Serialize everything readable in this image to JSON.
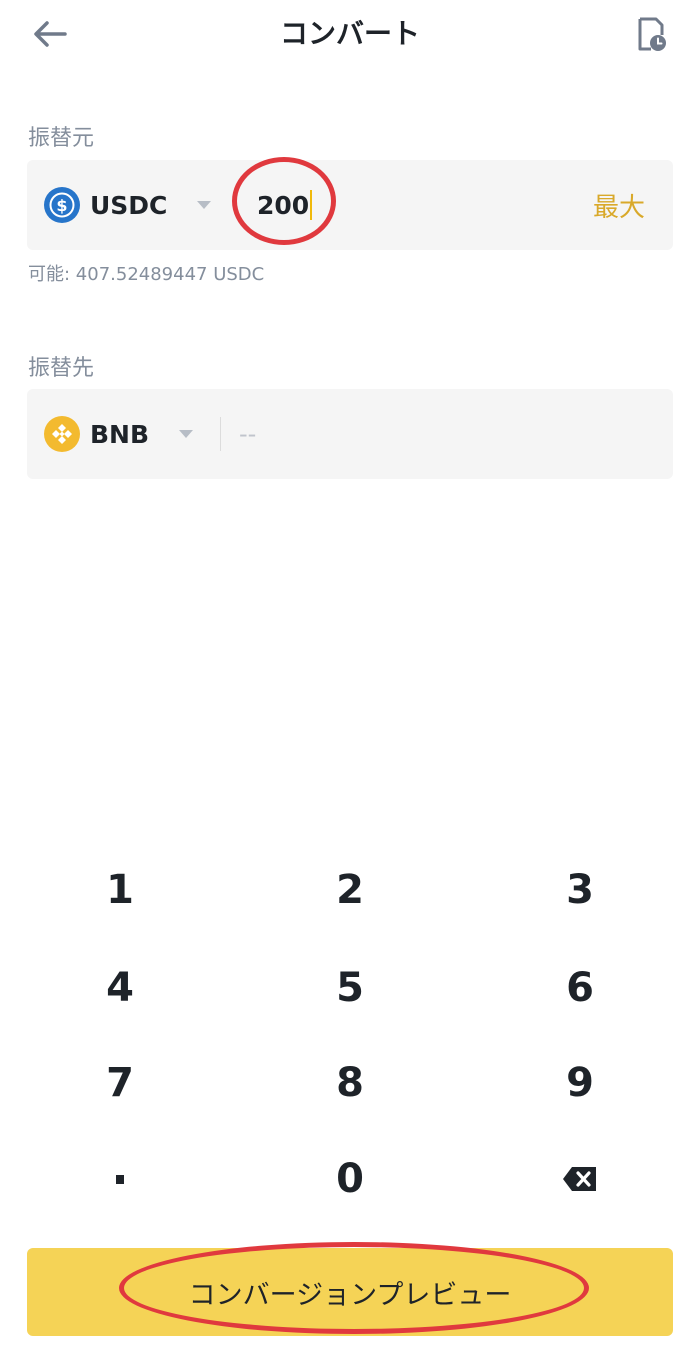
{
  "header": {
    "title": "コンバート",
    "back_icon": "arrow-left-icon",
    "history_icon": "order-history-icon"
  },
  "from": {
    "label": "振替元",
    "coin": "USDC",
    "coin_icon": "usdc-coin-icon",
    "amount": "200",
    "max_label": "最大",
    "available": "可能: 407.52489447 USDC"
  },
  "to": {
    "label": "振替先",
    "coin": "BNB",
    "coin_icon": "bnb-coin-icon",
    "amount_placeholder": "--"
  },
  "keypad": {
    "keys": [
      "1",
      "2",
      "3",
      "4",
      "5",
      "6",
      "7",
      "8",
      "9",
      "·",
      "0",
      "⌫"
    ]
  },
  "cta": {
    "label": "コンバージョンプレビュー"
  },
  "colors": {
    "accent": "#f0b90b",
    "cta_background": "#f5d356",
    "max_text": "#d9a92a",
    "annotation_red": "#e0393e",
    "usdc_blue": "#2775ca",
    "bnb_yellow": "#f3ba2f"
  }
}
